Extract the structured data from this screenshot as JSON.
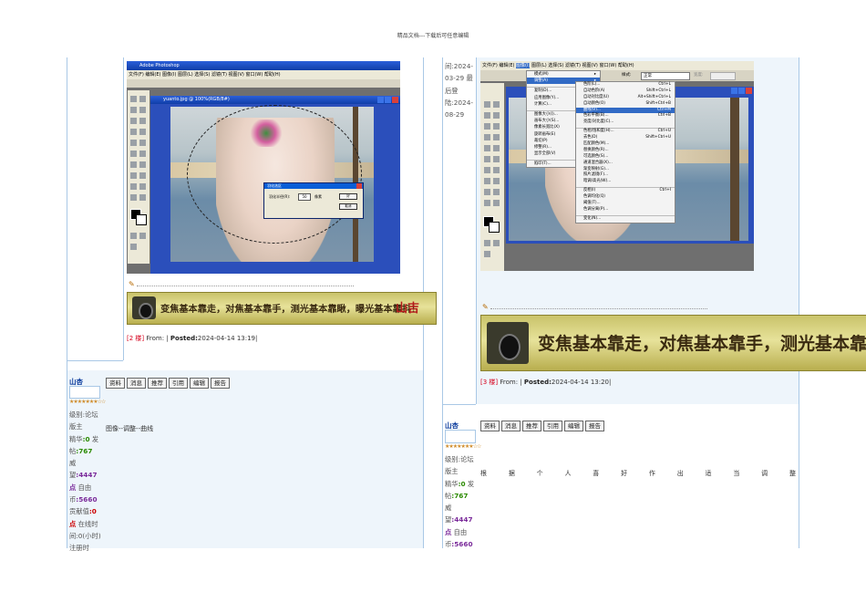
{
  "header": {
    "note": "精品文档---下载后可任意编辑"
  },
  "left_post": {
    "screenshot": {
      "app_title": "Adobe Photoshop",
      "menus": [
        "文件(F)",
        "编辑(E)",
        "图像(I)",
        "图层(L)",
        "选择(S)",
        "滤镜(T)",
        "视图(V)",
        "窗口(W)",
        "帮助(H)"
      ],
      "doc_title": "yuanto.jpg @ 100%(RGB/8#)",
      "dialog_title": "羽化选区",
      "dialog_label": "羽化半径(R):",
      "dialog_value": "50",
      "dialog_unit": "像素",
      "ok_label": "好",
      "cancel_label": "取消"
    },
    "banner_text": "变焦基本靠走，对焦基本靠手，测光基本靠瞅，曝光基本靠抖！",
    "banner_stamp": "山吉",
    "meta": {
      "floor": "[2 楼]",
      "from": "From: |",
      "posted_label": "Posted:",
      "posted_value": "2024-04-14 13:19|"
    }
  },
  "left_reply": {
    "username": "山杏",
    "stars": "★★★★★★★☆☆",
    "buttons": [
      "资料",
      "消息",
      "推荐",
      "引用",
      "编辑",
      "报告"
    ],
    "body": "图像--调整--曲线",
    "profile": {
      "level_label": "级别:",
      "level_value": "论坛版主",
      "essence_label": "精华",
      "essence_value": ":0",
      "posts_label": "发帖",
      "posts_value": ":767",
      "prestige_label": "威望",
      "prestige_value": ":4447",
      "points_label": "点",
      "free_label": "自由币",
      "free_value": ":5660",
      "contrib_label": "贡献值",
      "contrib_value": ":0",
      "online_label": "在线时间:",
      "online_value": "0(小时)",
      "reg_label": "注册时"
    }
  },
  "right_post": {
    "date_side": {
      "label1": "间:",
      "value1": "2024-03-29",
      "label2": "最后登陆:",
      "value2": "2024-08-29"
    },
    "screenshot": {
      "menus": [
        "文件(F)",
        "编辑(E)",
        "图像(I)",
        "图层(L)",
        "选择(S)",
        "滤镜(T)",
        "视图(V)",
        "窗口(W)",
        "帮助(H)"
      ],
      "option_check": "消除锯齿",
      "style_label": "样式:",
      "style_value": "正常",
      "width_label": "宽度:",
      "image_menu": [
        {
          "label": "模式(M)",
          "shortcut": "",
          "arrow": true
        },
        {
          "label": "调整(A)",
          "shortcut": "",
          "arrow": true,
          "selected": true
        },
        {
          "sep": true
        },
        {
          "label": "复制(D)...",
          "shortcut": ""
        },
        {
          "label": "应用图像(Y)...",
          "shortcut": ""
        },
        {
          "label": "计算(C)...",
          "shortcut": ""
        },
        {
          "sep": true
        },
        {
          "label": "图像大小(I)...",
          "shortcut": ""
        },
        {
          "label": "画布大小(S)...",
          "shortcut": ""
        },
        {
          "label": "像素长宽比(X)",
          "shortcut": "",
          "arrow": true
        },
        {
          "label": "旋转画布(E)",
          "shortcut": "",
          "arrow": true
        },
        {
          "label": "裁切(P)",
          "shortcut": ""
        },
        {
          "label": "修整(R)...",
          "shortcut": ""
        },
        {
          "label": "显示全部(V)",
          "shortcut": ""
        },
        {
          "sep": true
        },
        {
          "label": "陷印(T)...",
          "shortcut": ""
        }
      ],
      "adjust_menu": [
        {
          "label": "色阶(L)...",
          "shortcut": "Ctrl+L"
        },
        {
          "label": "自动色阶(A)",
          "shortcut": "Shift+Ctrl+L"
        },
        {
          "label": "自动对比度(U)",
          "shortcut": "Alt+Shift+Ctrl+L"
        },
        {
          "label": "自动颜色(O)",
          "shortcut": "Shift+Ctrl+B"
        },
        {
          "label": "曲线(V)...",
          "shortcut": "Ctrl+M",
          "selected": true
        },
        {
          "label": "色彩平衡(B)...",
          "shortcut": "Ctrl+B"
        },
        {
          "label": "亮度/对比度(C)...",
          "shortcut": ""
        },
        {
          "sep": true
        },
        {
          "label": "色相/饱和度(H)...",
          "shortcut": "Ctrl+U"
        },
        {
          "label": "去色(D)",
          "shortcut": "Shift+Ctrl+U"
        },
        {
          "label": "匹配颜色(M)...",
          "shortcut": ""
        },
        {
          "label": "替换颜色(R)...",
          "shortcut": ""
        },
        {
          "label": "可选颜色(S)...",
          "shortcut": ""
        },
        {
          "label": "通道混合器(X)...",
          "shortcut": ""
        },
        {
          "label": "渐变映射(G)...",
          "shortcut": ""
        },
        {
          "label": "照片滤镜(F)...",
          "shortcut": ""
        },
        {
          "label": "暗调/高光(W)...",
          "shortcut": ""
        },
        {
          "sep": true
        },
        {
          "label": "反相(I)",
          "shortcut": "Ctrl+I"
        },
        {
          "label": "色调均化(Q)",
          "shortcut": ""
        },
        {
          "label": "阈值(T)...",
          "shortcut": ""
        },
        {
          "label": "色调分离(P)...",
          "shortcut": ""
        },
        {
          "sep": true
        },
        {
          "label": "变化(N)...",
          "shortcut": ""
        }
      ]
    },
    "banner_text": "变焦基本靠走，对焦基本靠手，测光基本靠瞅，曝",
    "meta": {
      "floor": "[3 楼]",
      "from": "From: |",
      "posted_label": "Posted:",
      "posted_value": "2024-04-14 13:20|"
    }
  },
  "right_reply": {
    "username": "山杏",
    "stars": "★★★★★★★☆☆",
    "buttons": [
      "资料",
      "消息",
      "推荐",
      "引用",
      "编辑",
      "报告"
    ],
    "body_chars": [
      "根",
      "据",
      "个",
      "人",
      "喜",
      "好",
      "作",
      "出",
      "适",
      "当",
      "调",
      "整"
    ],
    "profile": {
      "level_label": "级别:",
      "level_value": "论坛版主",
      "essence_label": "精华",
      "essence_value": ":0",
      "posts_label": "发帖",
      "posts_value": ":767",
      "prestige_label": "威望",
      "prestige_value": ":4447",
      "points_label": "点",
      "free_label": "自由币",
      "free_value": ":5660"
    }
  }
}
